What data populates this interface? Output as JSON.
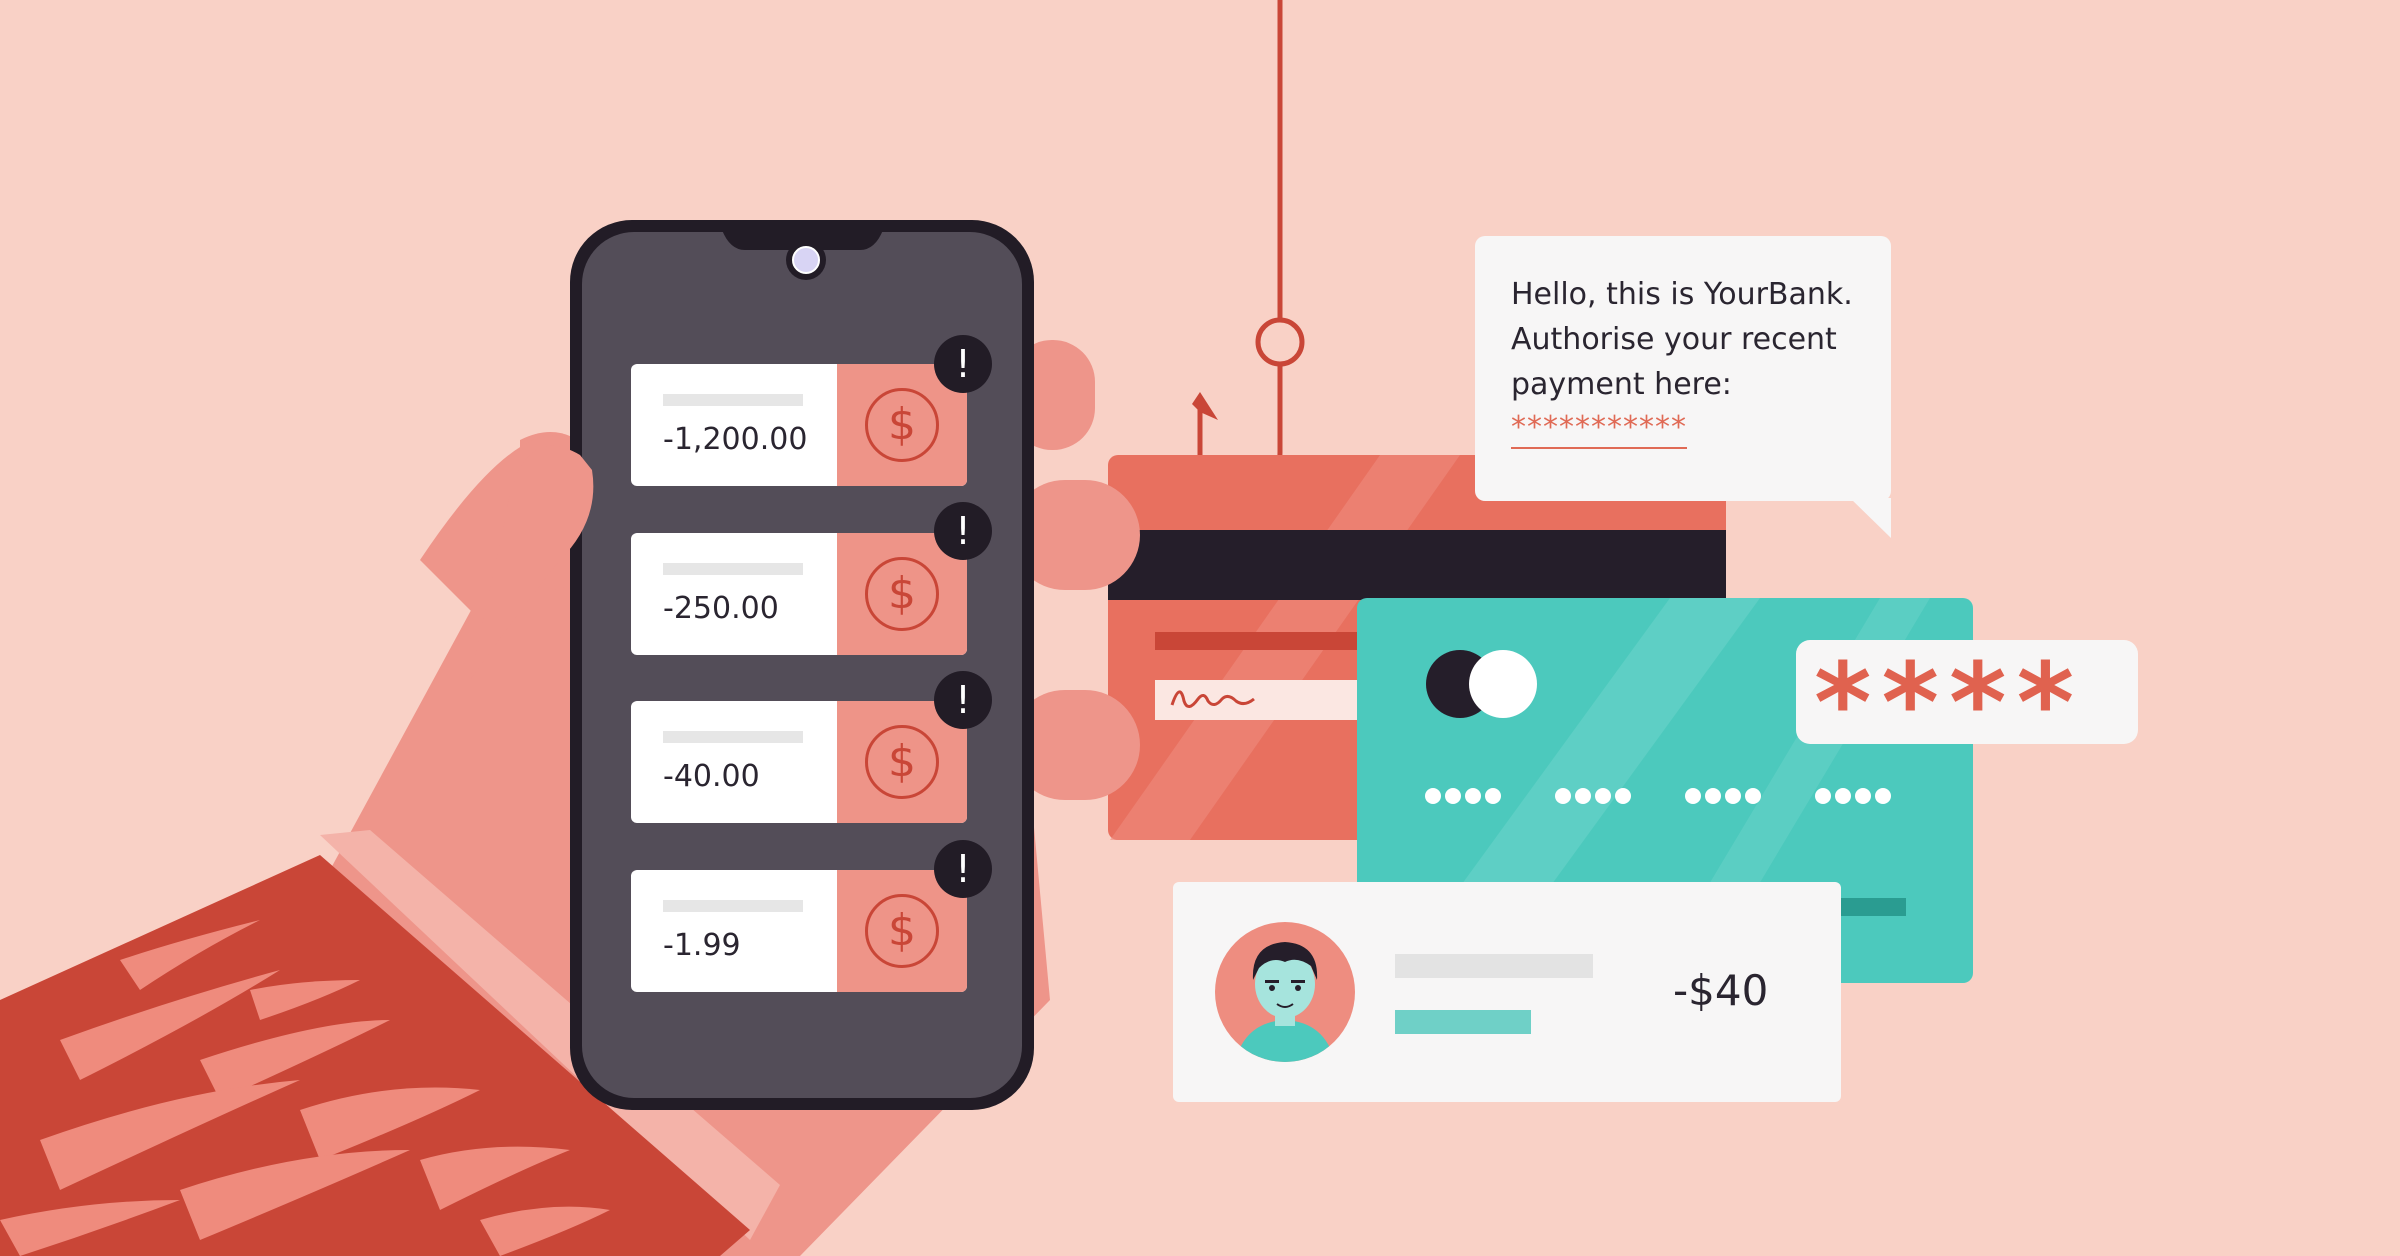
{
  "transactions": [
    {
      "amount": "-1,200.00",
      "alert": "!"
    },
    {
      "amount": "-250.00",
      "alert": "!"
    },
    {
      "amount": "-40.00",
      "alert": "!"
    },
    {
      "amount": "-1.99",
      "alert": "!"
    }
  ],
  "currency_symbol": "$",
  "message": {
    "text": "Hello, this is YourBank. Authorise your recent payment here:",
    "link_masked": "***********"
  },
  "pin_masked": "****",
  "payment": {
    "amount": "-$40"
  },
  "colors": {
    "background": "#f9d1c6",
    "phone": "#534d58",
    "accent_red": "#e0624f",
    "teal": "#4cc9bd",
    "dark": "#221c26"
  }
}
